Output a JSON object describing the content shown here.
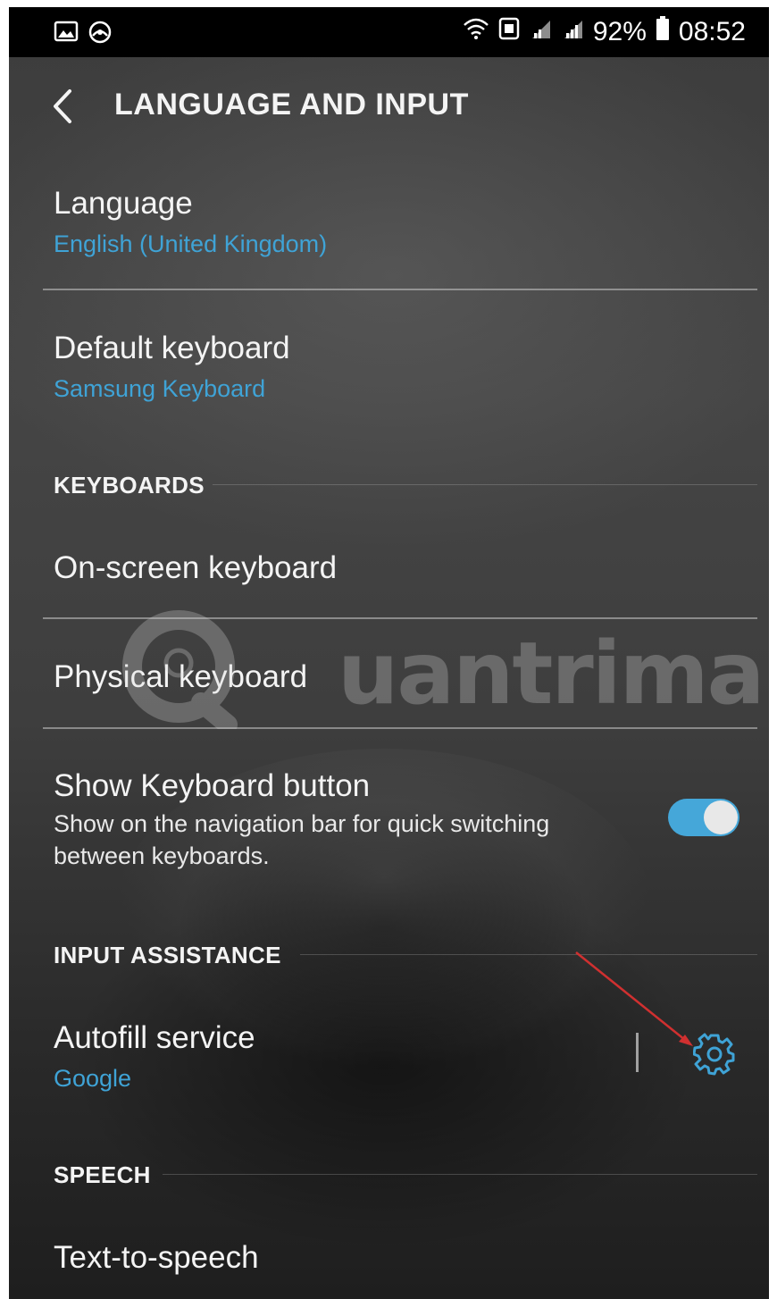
{
  "status_bar": {
    "battery_percent": "92%",
    "time": "08:52",
    "left_icons": [
      "gallery-icon",
      "browser-icon"
    ],
    "right_icons": [
      "wifi-icon",
      "nfc-icon",
      "signal-icon",
      "signal-icon",
      "battery-icon"
    ]
  },
  "header": {
    "title": "LANGUAGE AND INPUT",
    "back_icon": "chevron-left-icon"
  },
  "items": {
    "language": {
      "title": "Language",
      "subtitle": "English (United Kingdom)"
    },
    "default_keyboard": {
      "title": "Default keyboard",
      "subtitle": "Samsung Keyboard"
    },
    "on_screen_keyboard": {
      "title": "On-screen keyboard"
    },
    "physical_keyboard": {
      "title": "Physical keyboard"
    },
    "show_keyboard_button": {
      "title": "Show Keyboard button",
      "description": "Show on the navigation bar for quick switching between keyboards.",
      "toggle_on": true
    },
    "autofill_service": {
      "title": "Autofill service",
      "subtitle": "Google",
      "settings_icon": "gear-icon"
    },
    "text_to_speech": {
      "title": "Text-to-speech"
    }
  },
  "sections": {
    "keyboards": "KEYBOARDS",
    "input_assistance": "INPUT ASSISTANCE",
    "speech": "SPEECH"
  },
  "watermark": {
    "text": "uantrimang"
  },
  "colors": {
    "accent": "#3fa3d6",
    "toggle_track": "#45a7d9",
    "arrow": "#d03030"
  }
}
